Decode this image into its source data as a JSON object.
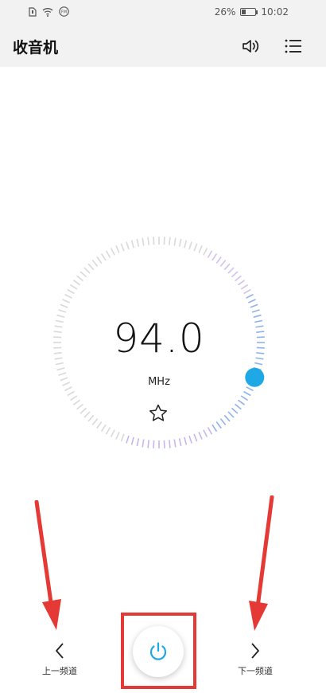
{
  "status_bar": {
    "battery": "26%",
    "battery_level": 0.26,
    "time": "10:02",
    "left_icons": [
      "sim-icon",
      "wifi-icon",
      "fm-icon"
    ]
  },
  "app_bar": {
    "title": "收音机",
    "icons": [
      "speaker-icon",
      "list-icon"
    ]
  },
  "tuner": {
    "frequency": "94.0",
    "unit": "MHz",
    "favorite_icon": "star-outline-icon",
    "accent_color": "#1fa8e6"
  },
  "controls": {
    "prev_label": "上一频道",
    "next_label": "下一频道",
    "power_icon": "power-icon"
  },
  "annotations": {
    "arrow_color": "#e53935",
    "highlight_color": "#e53935"
  }
}
